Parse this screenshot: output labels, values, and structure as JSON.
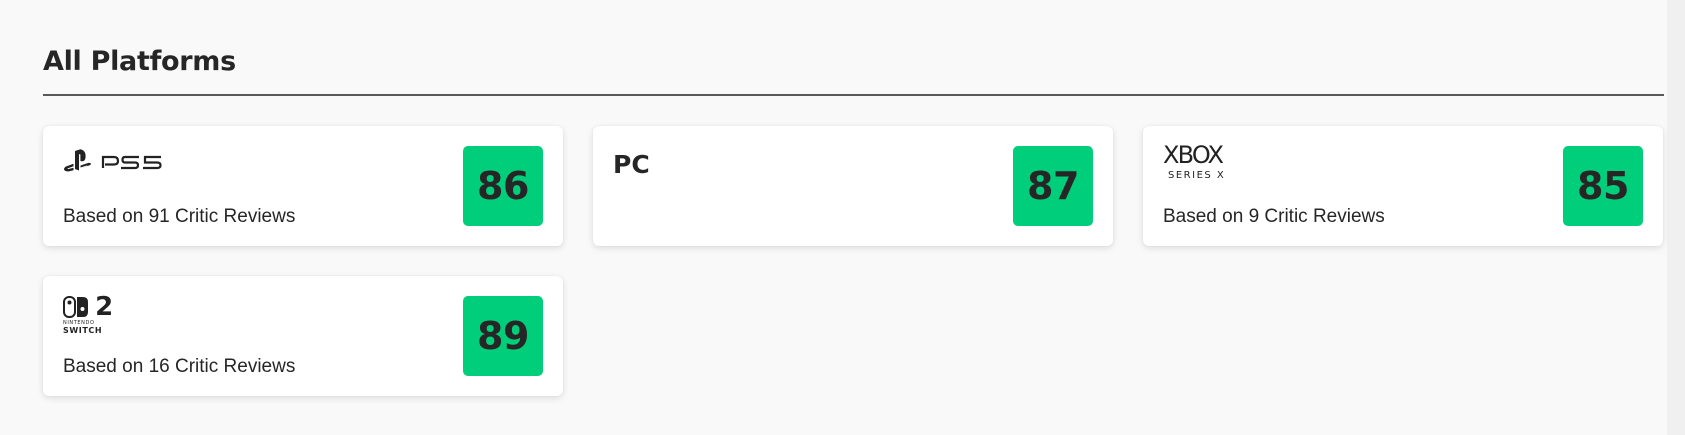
{
  "section": {
    "title": "All Platforms"
  },
  "platforms": [
    {
      "logo": "ps5-logo",
      "reviews": "Based on 91 Critic Reviews",
      "score": "86",
      "score_color": "#00ce7a"
    },
    {
      "logo_text": "PC",
      "score": "87",
      "score_color": "#00ce7a"
    },
    {
      "logo": "xbox-series-x-logo",
      "logo_text": "XBOX",
      "logo_subtext": "SERIES X",
      "reviews": "Based on 9 Critic Reviews",
      "score": "85",
      "score_color": "#00ce7a"
    },
    {
      "logo": "nintendo-switch-2-logo",
      "logo_text": "2",
      "logo_subtext_1": "NINTENDO",
      "logo_subtext_2": "SWITCH",
      "reviews": "Based on 16 Critic Reviews",
      "score": "89",
      "score_color": "#00ce7a"
    }
  ]
}
